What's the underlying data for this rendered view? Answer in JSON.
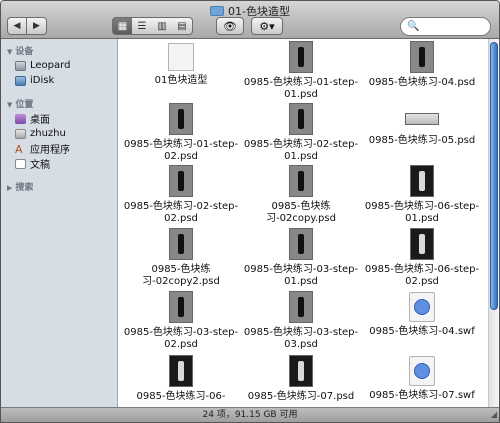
{
  "window": {
    "title": "01-色块造型"
  },
  "toolbar": {
    "back": "◀",
    "forward": "▶",
    "view_icon": "▦",
    "view_list": "☰",
    "view_columns": "▥",
    "view_coverflow": "▤",
    "quicklook": "👁",
    "action": "⚙▾",
    "search_placeholder": ""
  },
  "sidebar": {
    "sections": [
      {
        "label": "设备",
        "items": [
          {
            "label": "Leopard",
            "icon": "disk-icon"
          },
          {
            "label": "iDisk",
            "icon": "idisk-icon"
          }
        ]
      },
      {
        "label": "位置",
        "items": [
          {
            "label": "桌面",
            "icon": "desktop-icon"
          },
          {
            "label": "zhuzhu",
            "icon": "home-icon"
          },
          {
            "label": "应用程序",
            "icon": "applications-icon"
          },
          {
            "label": "文稿",
            "icon": "documents-icon"
          }
        ]
      },
      {
        "label": "搜索",
        "items": []
      }
    ]
  },
  "files": [
    {
      "name": "01色块造型",
      "kind": "doc"
    },
    {
      "name": "0985-色块练习-01-step-01.psd",
      "kind": "psd"
    },
    {
      "name": "0985-色块练习-04.psd",
      "kind": "psd"
    },
    {
      "name": "0985-色块练习-01-step-02.psd",
      "kind": "psd"
    },
    {
      "name": "0985-色块练习-02-step-01.psd",
      "kind": "psd"
    },
    {
      "name": "0985-色块练习-05.psd",
      "kind": "banner"
    },
    {
      "name": "0985-色块练习-02-step-02.psd",
      "kind": "psd"
    },
    {
      "name": "0985-色块练习-02copy.psd",
      "kind": "psd"
    },
    {
      "name": "0985-色块练习-06-step-01.psd",
      "kind": "dark"
    },
    {
      "name": "0985-色块练习-02copy2.psd",
      "kind": "psd"
    },
    {
      "name": "0985-色块练习-03-step-01.psd",
      "kind": "psd"
    },
    {
      "name": "0985-色块练习-06-step-02.psd",
      "kind": "dark"
    },
    {
      "name": "0985-色块练习-03-step-02.psd",
      "kind": "psd"
    },
    {
      "name": "0985-色块练习-03-step-03.psd",
      "kind": "psd"
    },
    {
      "name": "0985-色块练习-04.swf",
      "kind": "swf"
    },
    {
      "name": "0985-色块练习-06-",
      "kind": "dark"
    },
    {
      "name": "0985-色块练习-07.psd",
      "kind": "dark"
    },
    {
      "name": "0985-色块练习-07.swf",
      "kind": "swf"
    }
  ],
  "status": {
    "text": "24 项，91.15 GB 可用"
  }
}
